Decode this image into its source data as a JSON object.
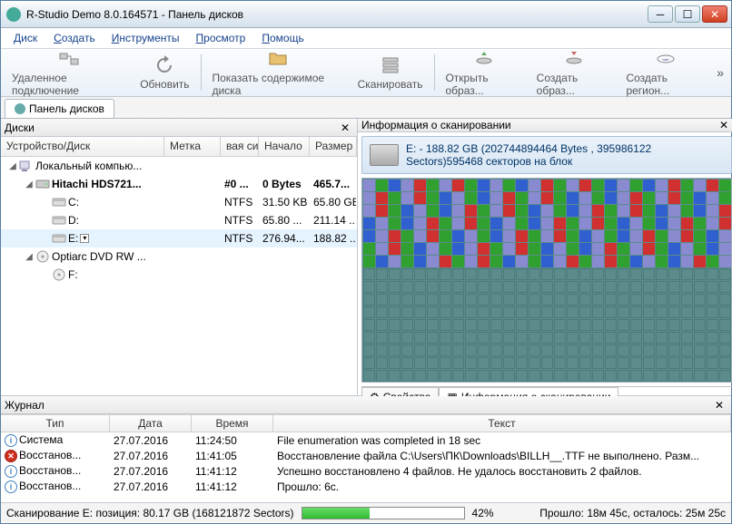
{
  "window": {
    "title": "R-Studio Demo 8.0.164571 - Панель дисков"
  },
  "menu": {
    "disk": "Диск",
    "create": "Создать",
    "tools": "Инструменты",
    "view": "Просмотр",
    "help": "Помощь"
  },
  "toolbar": {
    "remote": "Удаленное подключение",
    "refresh": "Обновить",
    "showcontent": "Показать содержимое диска",
    "scan": "Сканировать",
    "openimg": "Открыть образ...",
    "createimg": "Создать образ...",
    "createregion": "Создать регион..."
  },
  "tab": {
    "panel": "Панель дисков"
  },
  "left": {
    "title": "Диски",
    "cols": {
      "device": "Устройство/Диск",
      "label": "Метка",
      "fs": "вая си",
      "start": "Начало",
      "size": "Размер"
    },
    "rows": [
      {
        "indent": 0,
        "exp": "◢",
        "icon": "pc",
        "name": "Локальный компью...",
        "label": "",
        "fs": "",
        "start": "",
        "size": "",
        "bold": false
      },
      {
        "indent": 1,
        "exp": "◢",
        "icon": "hdd",
        "name": "Hitachi HDS721...",
        "label": "",
        "fs": "#0 ...",
        "start": "0 Bytes",
        "size": "465.7...",
        "bold": true
      },
      {
        "indent": 2,
        "exp": "",
        "icon": "vol",
        "name": "C:",
        "label": "",
        "fs": "NTFS",
        "start": "31.50 KB",
        "size": "65.80 GB",
        "bold": false
      },
      {
        "indent": 2,
        "exp": "",
        "icon": "vol",
        "name": "D:",
        "label": "",
        "fs": "NTFS",
        "start": "65.80 ...",
        "size": "211.14 ...",
        "bold": false
      },
      {
        "indent": 2,
        "exp": "",
        "icon": "vol",
        "name": "E:",
        "label": "",
        "fs": "NTFS",
        "start": "276.94...",
        "size": "188.82 ...",
        "bold": false,
        "sel": true,
        "dd": true
      },
      {
        "indent": 1,
        "exp": "◢",
        "icon": "dvd",
        "name": "Optiarc DVD RW ...",
        "label": "",
        "fs": "",
        "start": "",
        "size": "",
        "bold": false
      },
      {
        "indent": 2,
        "exp": "",
        "icon": "dvd",
        "name": "F:",
        "label": "",
        "fs": "",
        "start": "",
        "size": "",
        "bold": false
      }
    ]
  },
  "right": {
    "title": "Информация о сканировании",
    "drive_title": "E: - 188.82 GB (202744894464 Bytes , 395986122 Sectors)595468 секторов на блок",
    "tabs": {
      "props": "Свойства",
      "scan": "Информация о сканировании"
    }
  },
  "journal": {
    "title": "Журнал",
    "cols": {
      "type": "Тип",
      "date": "Дата",
      "time": "Время",
      "text": "Текст"
    },
    "rows": [
      {
        "icon": "info",
        "type": "Система",
        "date": "27.07.2016",
        "time": "11:24:50",
        "text": "File enumeration was completed in 18 sec"
      },
      {
        "icon": "err",
        "type": "Восстанов...",
        "date": "27.07.2016",
        "time": "11:41:05",
        "text": "Восстановление файла C:\\Users\\ПК\\Downloads\\BILLH__.TTF не выполнено. Разм..."
      },
      {
        "icon": "info",
        "type": "Восстанов...",
        "date": "27.07.2016",
        "time": "11:41:12",
        "text": "Успешно восстановлено 4 файлов. Не удалось восстановить 2 файлов."
      },
      {
        "icon": "info",
        "type": "Восстанов...",
        "date": "27.07.2016",
        "time": "11:41:12",
        "text": "Прошло: 6с."
      }
    ]
  },
  "status": {
    "scan": "Сканирование E: позиция: 80.17 GB (168121872 Sectors)",
    "pct": "42%",
    "elapsed": "Прошло: 18м 45с, осталось: 25м 25с",
    "progress": 42
  },
  "colors": {
    "blk_empty": "#5b8b8b",
    "blk_a": "#8a8ad0",
    "blk_b": "#3060d0",
    "blk_c": "#30a030",
    "blk_d": "#d03030"
  }
}
